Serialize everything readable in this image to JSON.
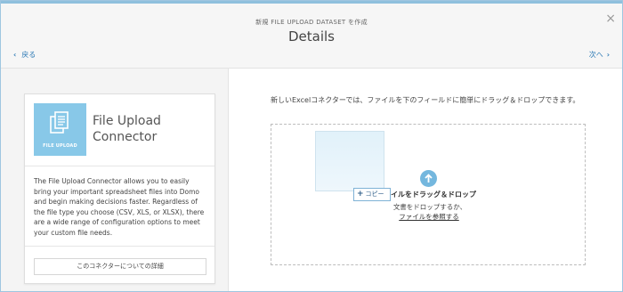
{
  "header": {
    "subtitle": "新規 FILE UPLOAD DATASET を作成",
    "title": "Details",
    "back_label": "戻る",
    "next_label": "次へ",
    "close_glyph": "×"
  },
  "connector_card": {
    "logo_label": "FILE UPLOAD",
    "title": "File Upload Connector",
    "description": "The File Upload Connector allows you to easily bring your important spreadsheet files into Domo and begin making decisions faster. Regardless of the file type you choose (CSV, XLS, or XLSX), there are a wide range of configuration options to meet your custom file needs.",
    "details_button": "このコネクターについての詳細"
  },
  "upload": {
    "instruction": "新しいExcelコネクターでは、ファイルを下のフィールドに簡単にドラッグ＆ドロップできます。",
    "copy_badge": "コピー",
    "drop_main_visible": "イルをドラッグ＆ドロップ",
    "drop_sub": "文書をドロップするか、",
    "browse_link": "ファイルを参照する"
  },
  "colors": {
    "accent": "#2f7bb5",
    "logo_bg": "#88c8e8",
    "upload_icon": "#74b7de"
  },
  "icons": [
    "close-icon",
    "chevron-left-icon",
    "chevron-right-icon",
    "file-upload-icon",
    "upload-arrow-icon",
    "plus-icon"
  ]
}
